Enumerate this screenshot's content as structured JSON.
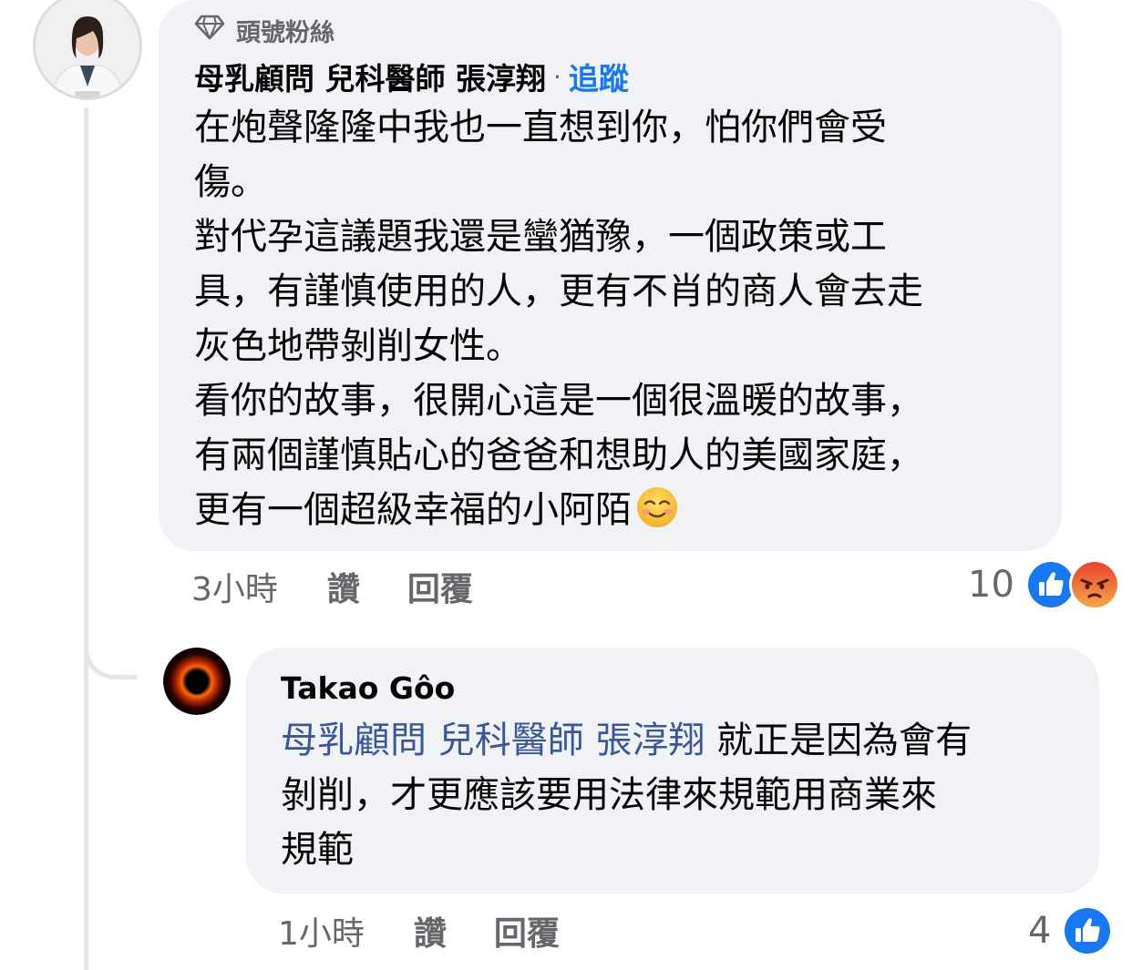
{
  "comment1": {
    "badge": "頭號粉絲",
    "author": "母乳顧問 兒科醫師 張淳翔",
    "separator": "·",
    "follow": "追蹤",
    "lines": [
      "在炮聲隆隆中我也一直想到你，怕你們會受",
      "傷。",
      "對代孕這議題我還是蠻猶豫，一個政策或工",
      "具，有謹慎使用的人，更有不肖的商人會去走",
      "灰色地帶剝削女性。",
      "看你的故事，很開心這是一個很溫暖的故事，",
      "有兩個謹慎貼心的爸爸和想助人的美國家庭，",
      "更有一個超級幸福的小阿陌"
    ],
    "emoji": "smiling-face-icon",
    "time": "3小時",
    "like_label": "讚",
    "reply_label": "回覆",
    "reaction_count": "10",
    "reactions": [
      "like-icon",
      "angry-icon"
    ]
  },
  "comment2": {
    "author": "Takao Gôo",
    "mention": "母乳顧問 兒科醫師 張淳翔",
    "line1_rest": " 就正是因為會有",
    "lines": [
      "剝削，才更應該要用法律來規範用商業來",
      "規範"
    ],
    "time": "1小時",
    "like_label": "讚",
    "reply_label": "回覆",
    "reaction_count": "4",
    "reactions": [
      "like-icon"
    ]
  },
  "colors": {
    "bubble": "#f0f2f5",
    "link": "#1877f2",
    "mention": "#385898",
    "meta": "#65676b",
    "like": "#1877f2",
    "angry": "#f0533c"
  }
}
